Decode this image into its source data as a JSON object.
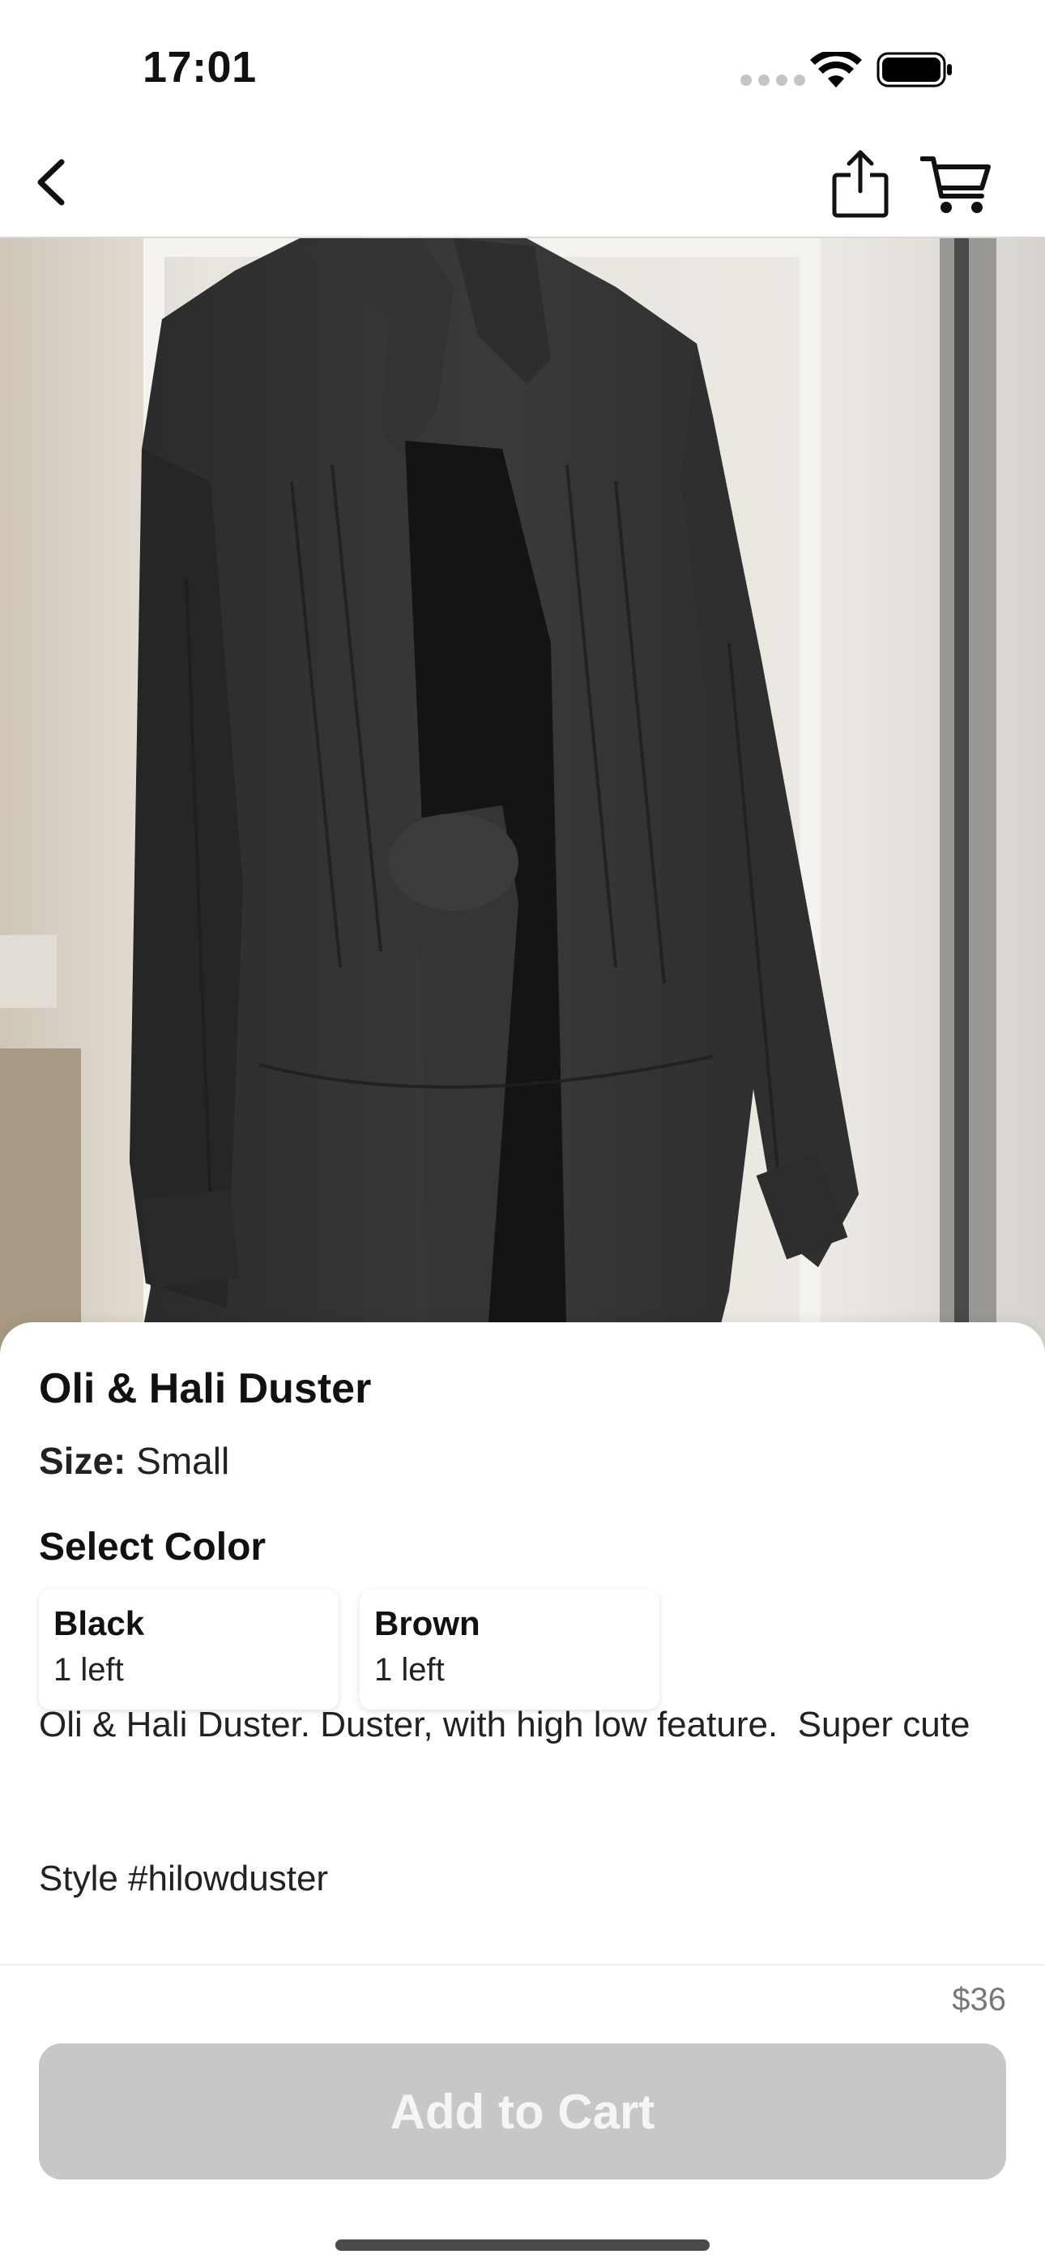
{
  "status_bar": {
    "time": "17:01"
  },
  "nav": {
    "back_icon": "chevron-left-icon",
    "share_icon": "share-icon",
    "cart_icon": "cart-icon"
  },
  "product": {
    "title": "Oli & Hali Duster",
    "size_label": "Size:",
    "size_value": " Small",
    "select_color_label": "Select Color",
    "colors": [
      {
        "name": "Black",
        "stock": "1 left"
      },
      {
        "name": "Brown",
        "stock": "1 left"
      }
    ],
    "description": "Oli & Hali Duster. Duster, with high low feature.  Super cute",
    "style_line": "Style #hilowduster",
    "price": "$36"
  },
  "actions": {
    "add_to_cart_label": "Add to Cart"
  },
  "colors": {
    "button_disabled": "#c7c7c7",
    "background": "#ffffff"
  }
}
